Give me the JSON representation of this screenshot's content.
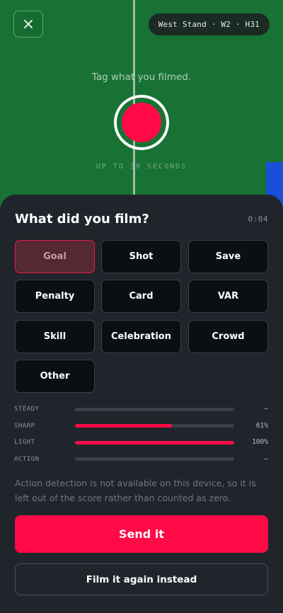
{
  "camera": {
    "seat_label": "West Stand · W2 · H31",
    "prompt": "Tag what you filmed.",
    "limit_text": "UP TO 30 SECONDS"
  },
  "sheet": {
    "title": "What did you film?",
    "timer": "0:04",
    "tags": [
      {
        "label": "Goal",
        "selected": true
      },
      {
        "label": "Shot",
        "selected": false
      },
      {
        "label": "Save",
        "selected": false
      },
      {
        "label": "Penalty",
        "selected": false
      },
      {
        "label": "Card",
        "selected": false
      },
      {
        "label": "VAR",
        "selected": false
      },
      {
        "label": "Skill",
        "selected": false
      },
      {
        "label": "Celebration",
        "selected": false
      },
      {
        "label": "Crowd",
        "selected": false
      },
      {
        "label": "Other",
        "selected": false
      }
    ],
    "metrics": [
      {
        "label": "STEADY",
        "value_text": "—",
        "level": null
      },
      {
        "label": "SHARP",
        "value_text": "61%",
        "level": 0.61
      },
      {
        "label": "LIGHT",
        "value_text": "100%",
        "level": 1.0
      },
      {
        "label": "ACTION",
        "value_text": "—",
        "level": null
      }
    ],
    "note": "Action detection is not available on this device, so it is left out of the score rather than counted as zero.",
    "send_label": "Send it",
    "again_label": "Film it again instead"
  },
  "colors": {
    "accent": "#ff0a47",
    "pitch": "#177234",
    "sheet_bg": "#1f252b"
  },
  "icons": {
    "close": "close-icon"
  }
}
